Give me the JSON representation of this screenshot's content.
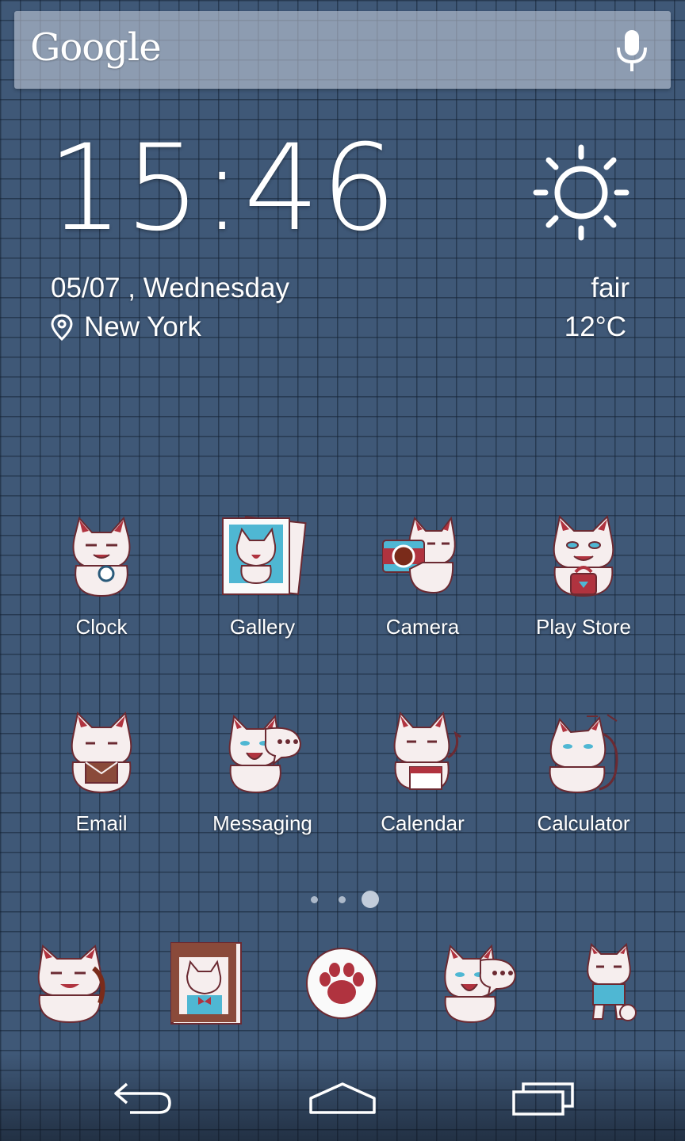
{
  "search": {
    "logo": "Google"
  },
  "clock": {
    "time": "15:46",
    "date": "05/07 , Wednesday",
    "location": "New York",
    "condition": "fair",
    "temperature": "12°C"
  },
  "apps": [
    {
      "label": "Clock",
      "icon": "cat-clock-icon"
    },
    {
      "label": "Gallery",
      "icon": "cat-gallery-icon"
    },
    {
      "label": "Camera",
      "icon": "cat-camera-icon"
    },
    {
      "label": "Play Store",
      "icon": "cat-play-store-icon"
    },
    {
      "label": "Email",
      "icon": "cat-email-icon"
    },
    {
      "label": "Messaging",
      "icon": "cat-messaging-icon"
    },
    {
      "label": "Calendar",
      "icon": "cat-calendar-icon"
    },
    {
      "label": "Calculator",
      "icon": "cat-calculator-icon"
    }
  ],
  "dock": [
    "cat-phone-icon",
    "cat-contacts-icon",
    "paw-apps-icon",
    "cat-messaging-icon",
    "cat-browser-icon"
  ],
  "page_indicator": {
    "count": 3,
    "active": 3
  },
  "colors": {
    "wallpaper": "#3f5877",
    "cat_red": "#b0333f",
    "cat_blue": "#4fb7d3"
  }
}
